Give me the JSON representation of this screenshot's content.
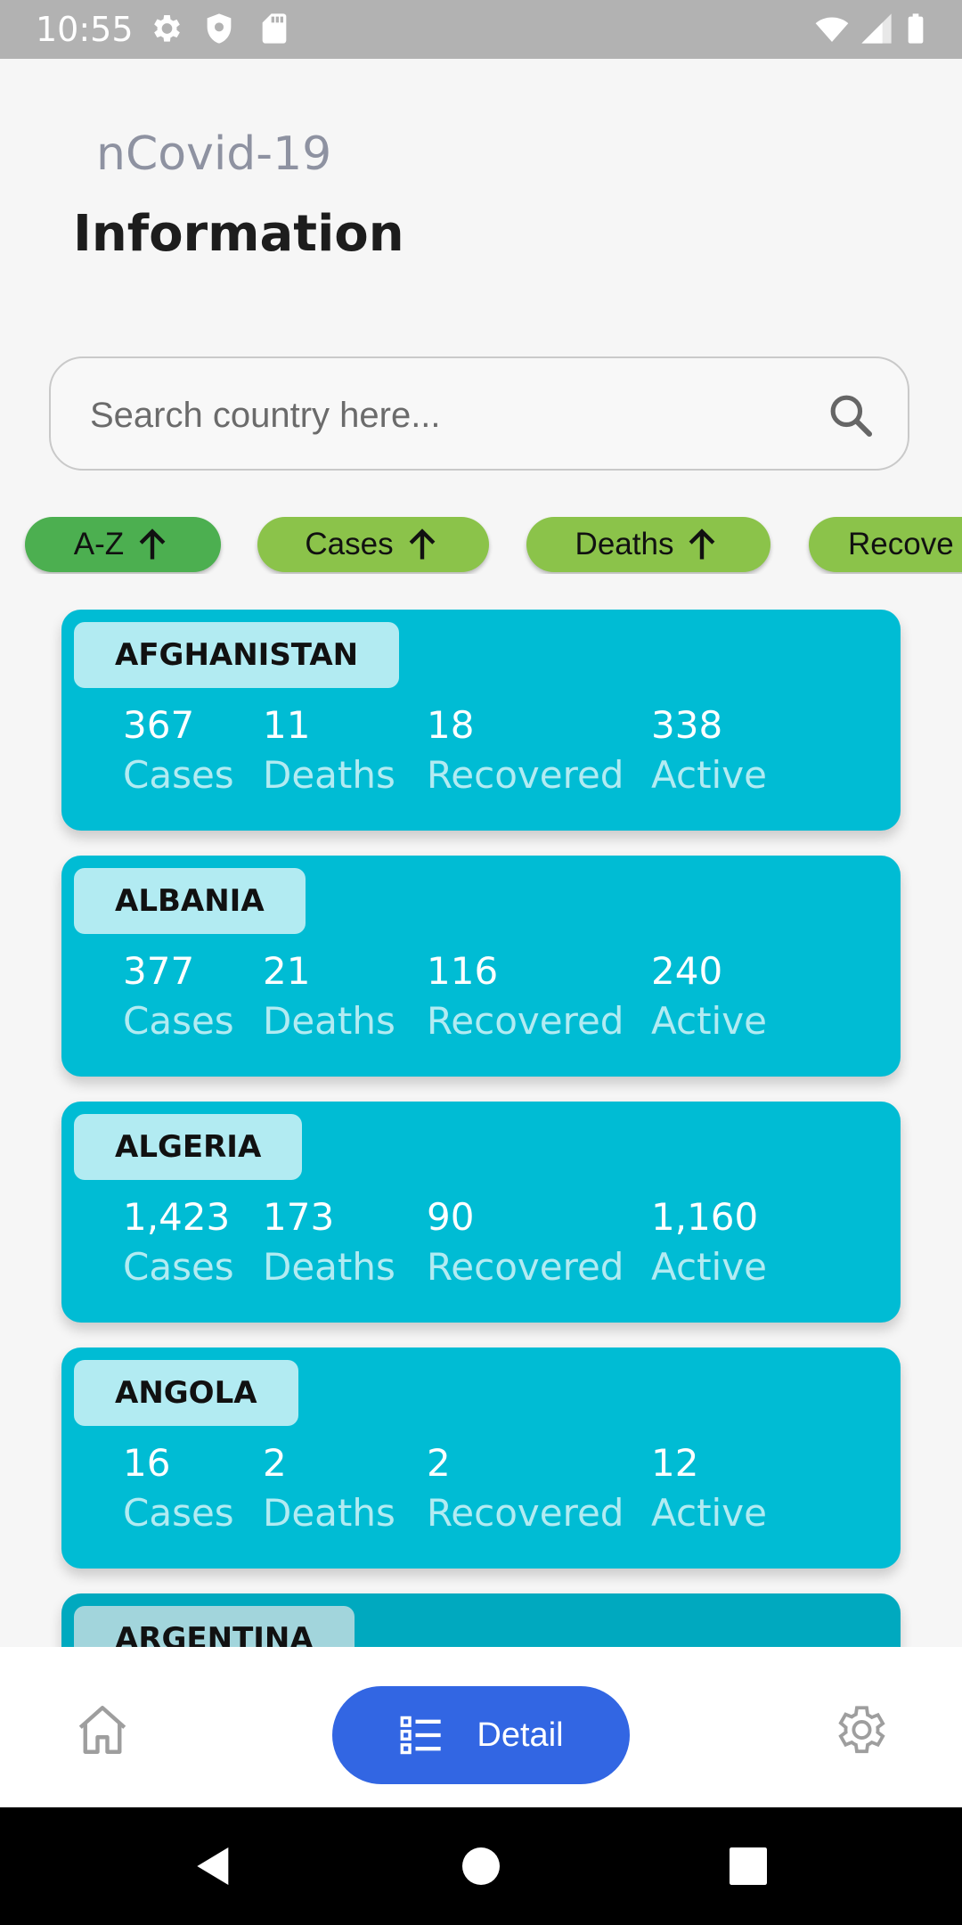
{
  "status_bar": {
    "time": "10:55",
    "icons": [
      "gear-icon",
      "shield-icon",
      "sd-card-icon",
      "wifi-icon",
      "signal-icon",
      "battery-icon"
    ]
  },
  "header": {
    "app_title": "nCovid-19",
    "page_title": "Information"
  },
  "search": {
    "placeholder": "Search country here...",
    "value": ""
  },
  "sort_chips": [
    {
      "label": "A-Z",
      "icon": "arrow-up-icon",
      "selected": true,
      "color": "#4caf50"
    },
    {
      "label": "Cases",
      "icon": "arrow-up-icon",
      "selected": false,
      "color": "#8bc34a"
    },
    {
      "label": "Deaths",
      "icon": "arrow-up-icon",
      "selected": false,
      "color": "#8bc34a"
    },
    {
      "label": "Recove",
      "icon": "",
      "selected": false,
      "color": "#8bc34a"
    }
  ],
  "stat_labels": {
    "cases": "Cases",
    "deaths": "Deaths",
    "recovered": "Recovered",
    "active": "Active"
  },
  "countries": [
    {
      "name": "AFGHANISTAN",
      "cases": "367",
      "deaths": "11",
      "recovered": "18",
      "active": "338"
    },
    {
      "name": "ALBANIA",
      "cases": "377",
      "deaths": "21",
      "recovered": "116",
      "active": "240"
    },
    {
      "name": "ALGERIA",
      "cases": "1,423",
      "deaths": "173",
      "recovered": "90",
      "active": "1,160"
    },
    {
      "name": "ANGOLA",
      "cases": "16",
      "deaths": "2",
      "recovered": "2",
      "active": "12"
    },
    {
      "name": "ARGENTINA",
      "cases": "",
      "deaths": "",
      "recovered": "",
      "active": ""
    }
  ],
  "bottom_nav": {
    "home_icon": "home-icon",
    "detail_label": "Detail",
    "detail_icon": "list-icon",
    "settings_icon": "gear-icon"
  },
  "colors": {
    "card": "#00bcd4",
    "card_tag": "#b2ebf2",
    "active_chip": "#4caf50",
    "chip": "#8bc34a",
    "nav_active": "#3266e3"
  }
}
